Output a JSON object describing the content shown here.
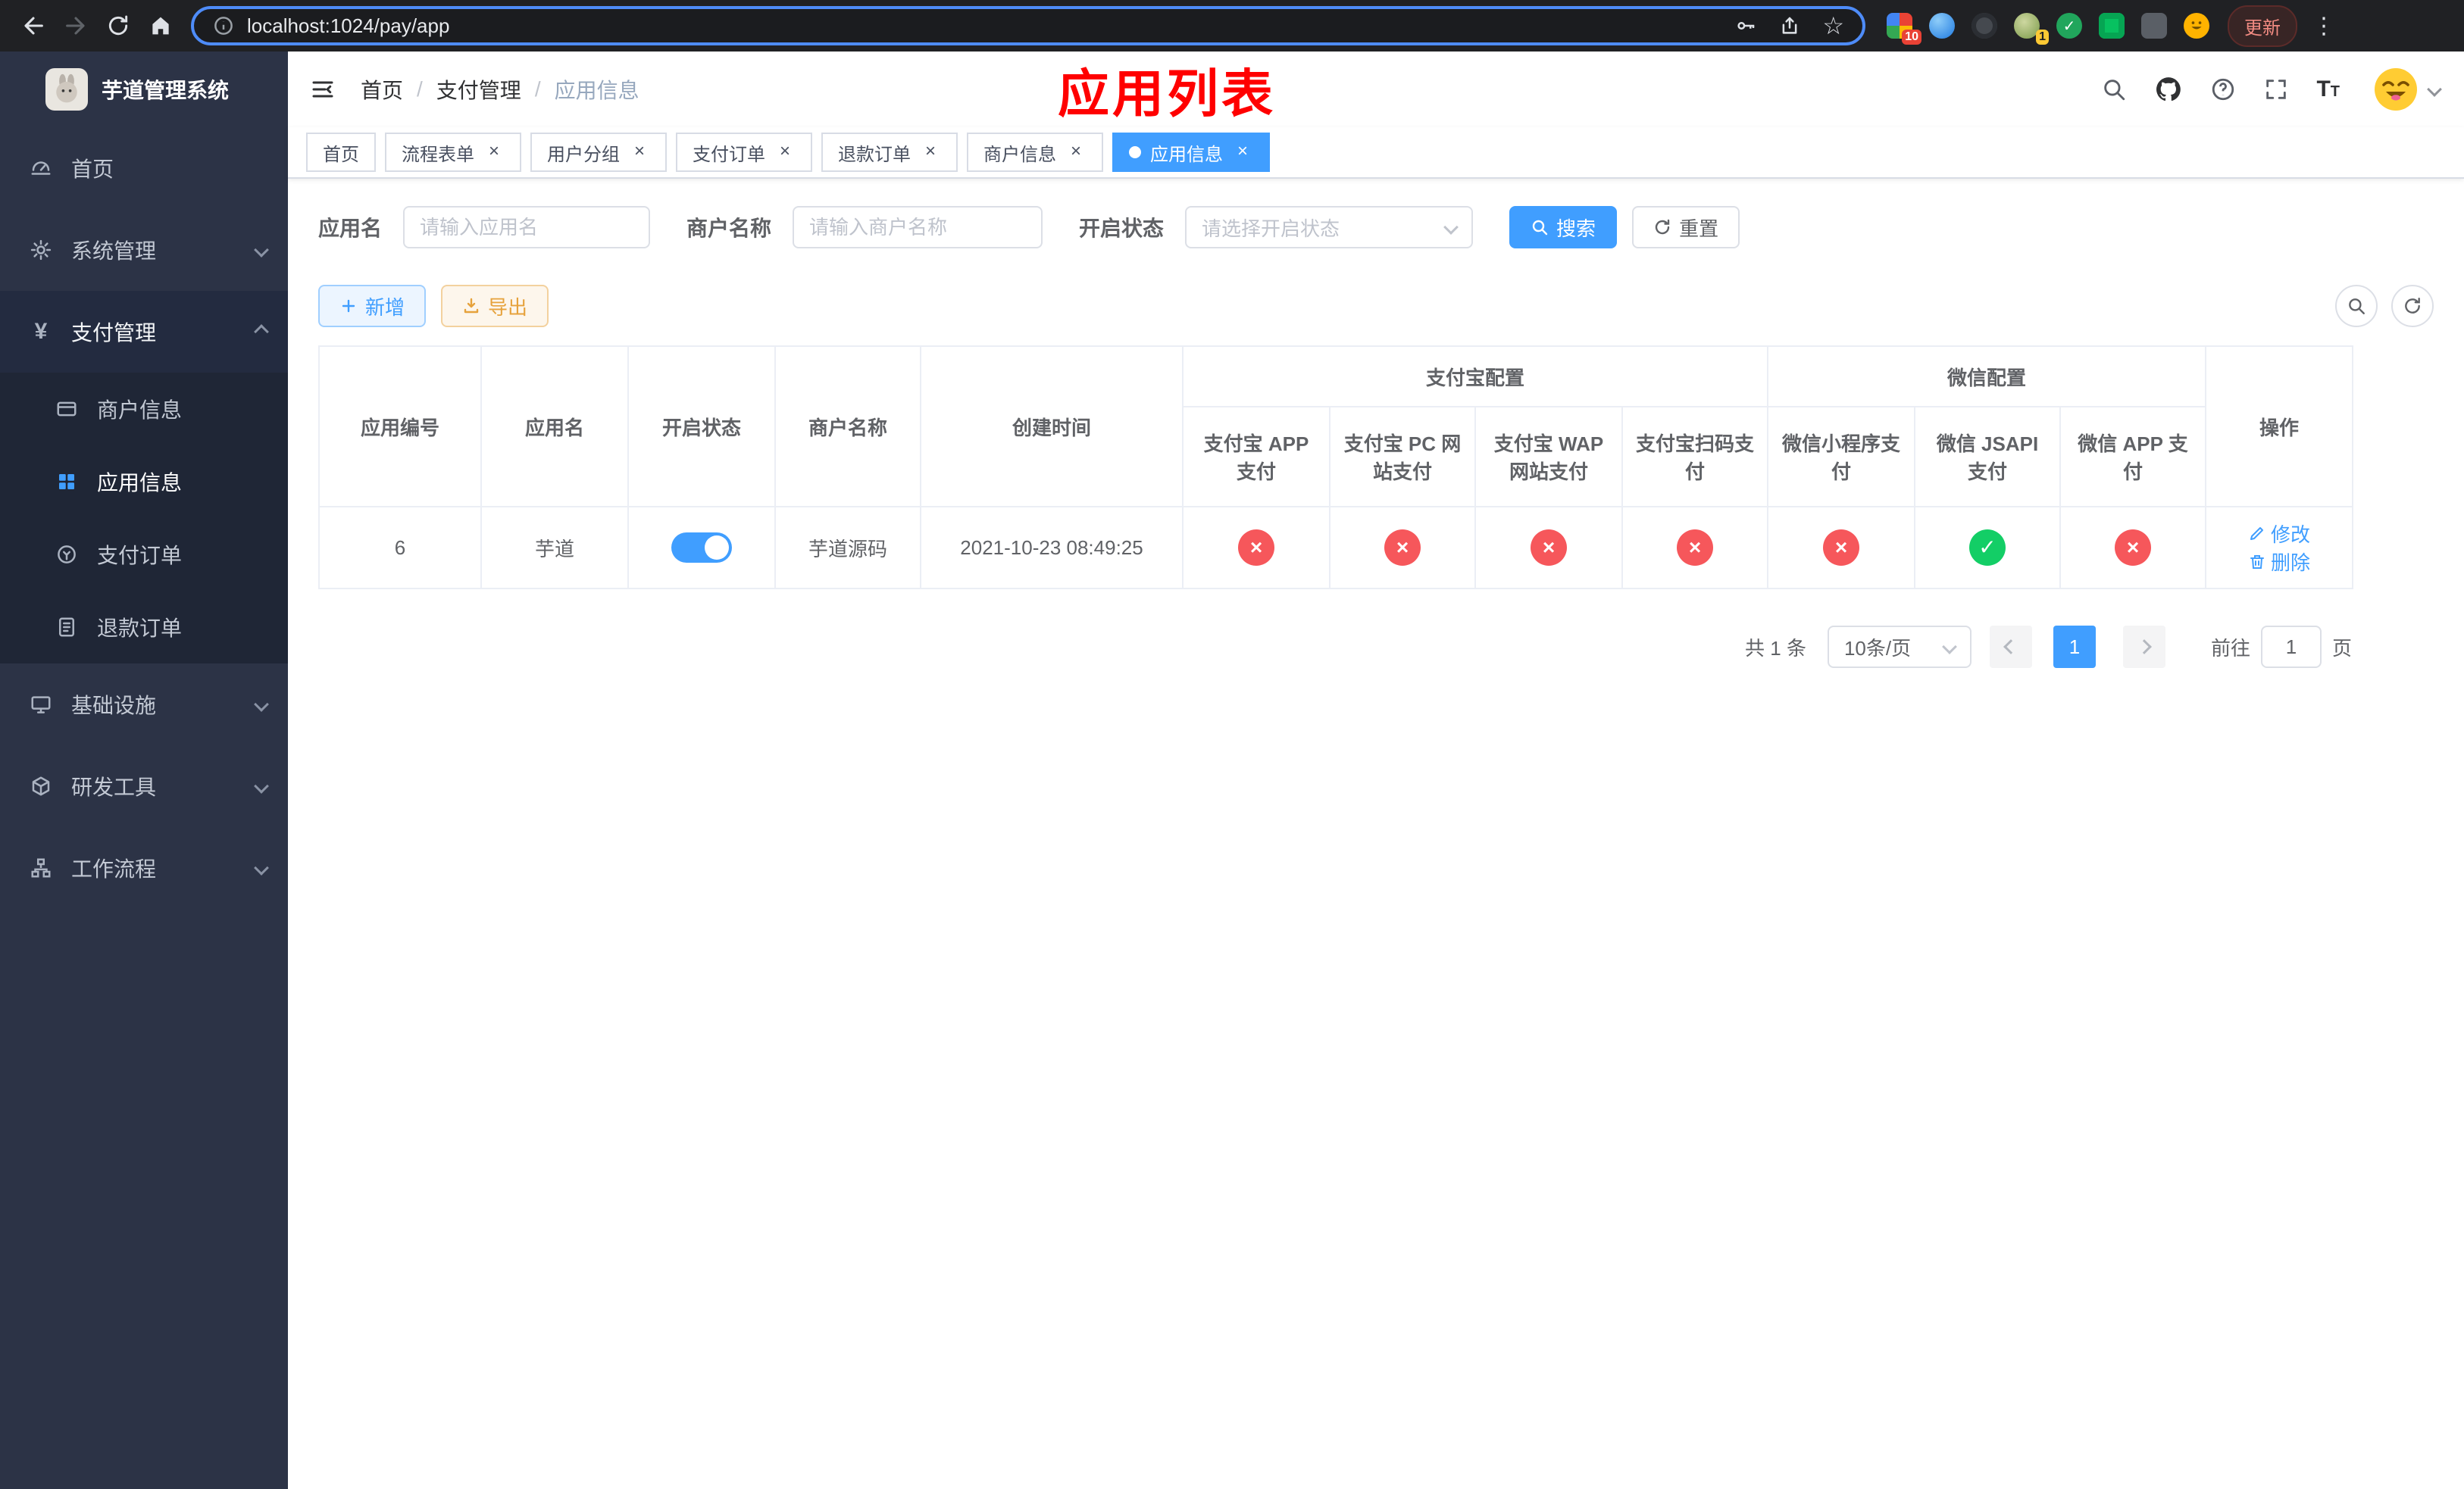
{
  "icons": {
    "close": "×",
    "check": "✓",
    "cross": "×",
    "star": "☆",
    "kebab": "⋮",
    "yen": "¥"
  },
  "browser": {
    "url": "localhost:1024/pay/app",
    "update_label": "更新",
    "ext_badge_1": "10",
    "ext_badge_2": "1"
  },
  "sidebar": {
    "title": "芋道管理系统",
    "items": [
      {
        "label": "首页"
      },
      {
        "label": "系统管理"
      },
      {
        "label": "支付管理"
      },
      {
        "label": "基础设施"
      },
      {
        "label": "研发工具"
      },
      {
        "label": "工作流程"
      }
    ],
    "payment_children": [
      {
        "label": "商户信息"
      },
      {
        "label": "应用信息"
      },
      {
        "label": "支付订单"
      },
      {
        "label": "退款订单"
      }
    ]
  },
  "header": {
    "breadcrumb": [
      {
        "label": "首页"
      },
      {
        "label": "支付管理"
      },
      {
        "label": "应用信息"
      }
    ],
    "separator": "/",
    "overlay_title": "应用列表"
  },
  "tabs": [
    {
      "label": "首页"
    },
    {
      "label": "流程表单"
    },
    {
      "label": "用户分组"
    },
    {
      "label": "支付订单"
    },
    {
      "label": "退款订单"
    },
    {
      "label": "商户信息"
    },
    {
      "label": "应用信息"
    }
  ],
  "filters": {
    "app_name_label": "应用名",
    "app_name_placeholder": "请输入应用名",
    "merchant_label": "商户名称",
    "merchant_placeholder": "请输入商户名称",
    "status_label": "开启状态",
    "status_placeholder": "请选择开启状态",
    "search_label": "搜索",
    "reset_label": "重置"
  },
  "toolbar": {
    "add_label": "新增",
    "export_label": "导出"
  },
  "table": {
    "groups": {
      "alipay": "支付宝配置",
      "wechat": "微信配置"
    },
    "columns": {
      "id": "应用编号",
      "name": "应用名",
      "status": "开启状态",
      "merchant": "商户名称",
      "created": "创建时间",
      "alipay_app": "支付宝 APP 支付",
      "alipay_pc": "支付宝 PC 网站支付",
      "alipay_wap": "支付宝 WAP 网站支付",
      "alipay_scan": "支付宝扫码支付",
      "wx_mini": "微信小程序支付",
      "wx_jsapi": "微信 JSAPI 支付",
      "wx_app": "微信 APP 支付",
      "actions": "操作"
    },
    "rows": [
      {
        "id": "6",
        "name": "芋道",
        "enabled": true,
        "merchant": "芋道源码",
        "created": "2021-10-23 08:49:25",
        "configs": [
          false,
          false,
          false,
          false,
          false,
          true,
          false
        ],
        "edit_label": "修改",
        "delete_label": "删除"
      }
    ]
  },
  "pagination": {
    "total": "共 1 条",
    "page_size": "10条/页",
    "page": "1",
    "goto_label": "前往",
    "goto_value": "1",
    "goto_unit": "页"
  }
}
